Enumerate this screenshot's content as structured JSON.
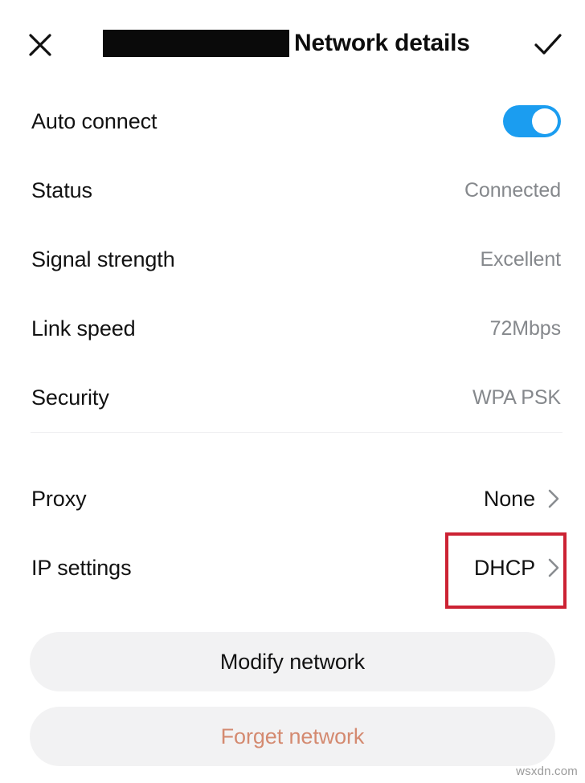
{
  "header": {
    "close_icon": "close-icon",
    "redacted_ssid": "",
    "title": "Network details",
    "confirm_icon": "check-icon"
  },
  "details": {
    "auto_connect": {
      "label": "Auto connect",
      "toggle_state": "on",
      "toggle_color": "#1b9df0"
    },
    "rows": [
      {
        "label": "Status",
        "value": "Connected"
      },
      {
        "label": "Signal strength",
        "value": "Excellent"
      },
      {
        "label": "Link speed",
        "value": "72Mbps"
      },
      {
        "label": "Security",
        "value": "WPA PSK"
      }
    ]
  },
  "settings": {
    "rows": [
      {
        "label": "Proxy",
        "value": "None",
        "chevron": "chevron-right-icon"
      },
      {
        "label": "IP settings",
        "value": "DHCP",
        "chevron": "chevron-right-icon"
      }
    ]
  },
  "annotation": {
    "target": "IP settings value",
    "color": "#cc2233"
  },
  "actions": {
    "modify": "Modify network",
    "forget": "Forget network",
    "forget_color": "#d48a70"
  },
  "watermark": "wsxdn.com"
}
